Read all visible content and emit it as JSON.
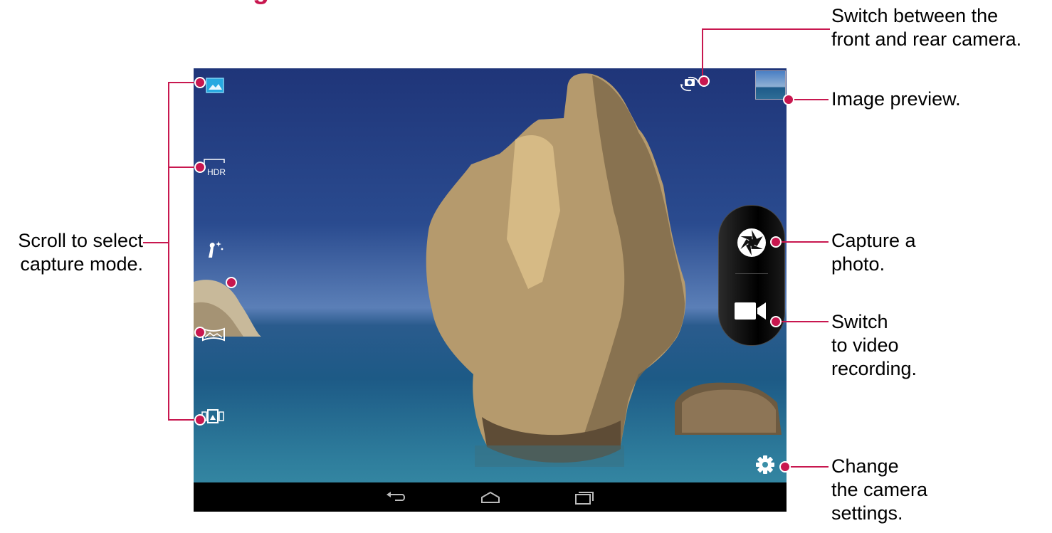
{
  "labels": {
    "switch_camera": [
      "Switch between the",
      "front and rear camera."
    ],
    "image_preview": "Image preview.",
    "capture_mode": [
      "Scroll to select",
      "capture mode."
    ],
    "capture_photo": [
      "Capture a",
      "photo."
    ],
    "switch_video": [
      "Switch",
      "to video",
      "recording."
    ],
    "camera_settings": [
      "Change",
      "the camera",
      "settings."
    ]
  },
  "camera_ui": {
    "hdr_label": "HDR",
    "modes": [
      "photo-mode-icon",
      "hdr-mode-icon",
      "beauty-mode-icon",
      "panorama-mode-icon",
      "photo-sphere-mode-icon"
    ],
    "icons": [
      "switch-camera-icon",
      "image-preview-thumbnail",
      "shutter-icon",
      "video-camera-icon",
      "gear-icon",
      "back-icon",
      "home-icon",
      "recent-apps-icon"
    ]
  },
  "colors": {
    "accent": "#c8174f",
    "mode_selected": "#27a9e1"
  }
}
